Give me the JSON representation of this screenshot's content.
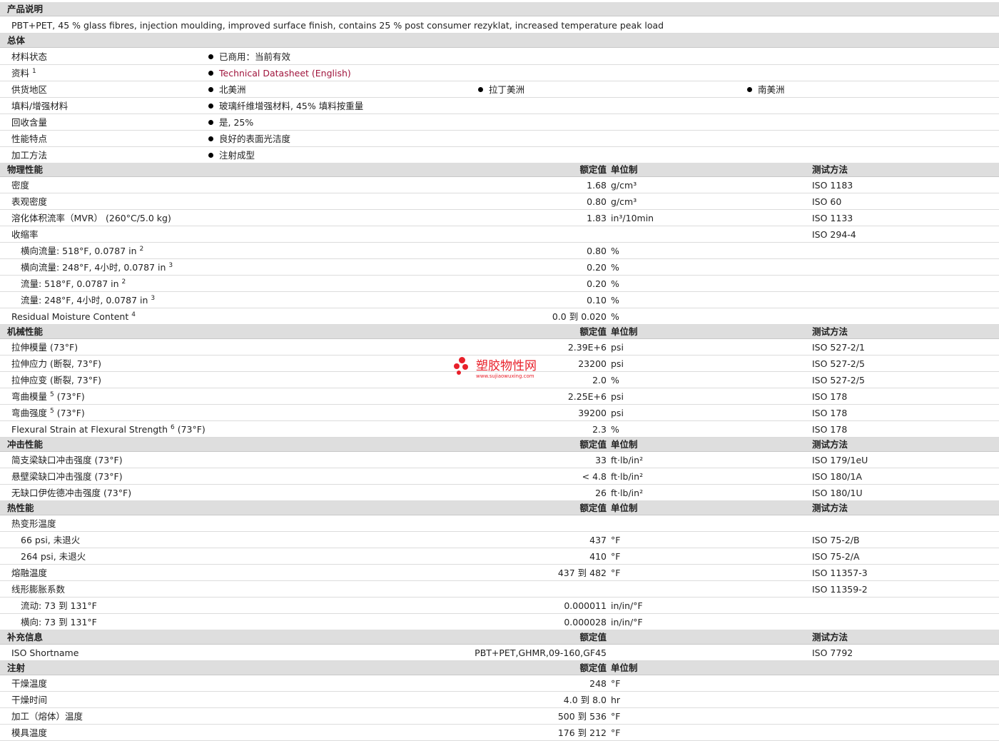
{
  "sections": {
    "product_desc": {
      "title": "产品说明",
      "text": "PBT+PET, 45 % glass fibres, injection moulding, improved surface finish, contains 25 % post consumer rezyklat, increased temperature peak load"
    },
    "general": {
      "title": "总体",
      "rows": [
        {
          "label": "材料状态",
          "sup": "",
          "items": [
            "已商用：当前有效"
          ]
        },
        {
          "label": "资料",
          "sup": "1",
          "items": [
            "Technical Datasheet (English)"
          ]
        },
        {
          "label": "供货地区",
          "sup": "",
          "items": [
            "北美洲",
            "拉丁美洲",
            "南美洲"
          ]
        },
        {
          "label": "填料/增强材料",
          "sup": "",
          "items": [
            "玻璃纤维增强材料, 45% 填料按重量"
          ]
        },
        {
          "label": "回收含量",
          "sup": "",
          "items": [
            "是, 25%"
          ]
        },
        {
          "label": "性能特点",
          "sup": "",
          "items": [
            "良好的表面光洁度"
          ]
        },
        {
          "label": "加工方法",
          "sup": "",
          "items": [
            "注射成型"
          ]
        }
      ]
    },
    "physical": {
      "title": "物理性能",
      "h_val": "额定值",
      "h_unit": "单位制",
      "h_test": "测试方法",
      "rows": [
        {
          "label": "密度",
          "val": "1.68",
          "unit": "g/cm³",
          "test": "ISO 1183"
        },
        {
          "label": "表观密度",
          "val": "0.80",
          "unit": "g/cm³",
          "test": "ISO 60"
        },
        {
          "label": "溶化体积流率（MVR） (260°C/5.0 kg)",
          "val": "1.83",
          "unit": "in³/10min",
          "test": "ISO 1133"
        },
        {
          "label": "收缩率",
          "val": "",
          "unit": "",
          "test": "ISO 294-4"
        },
        {
          "label": "横向流量: 518°F, 0.0787 in",
          "sup": "2",
          "indent": true,
          "val": "0.80",
          "unit": "%",
          "test": ""
        },
        {
          "label": "横向流量: 248°F, 4小时, 0.0787 in",
          "sup": "3",
          "indent": true,
          "val": "0.20",
          "unit": "%",
          "test": ""
        },
        {
          "label": "流量: 518°F, 0.0787 in",
          "sup": "2",
          "indent": true,
          "val": "0.20",
          "unit": "%",
          "test": ""
        },
        {
          "label": "流量: 248°F, 4小时, 0.0787 in",
          "sup": "3",
          "indent": true,
          "val": "0.10",
          "unit": "%",
          "test": ""
        },
        {
          "label": "Residual Moisture Content",
          "sup": "4",
          "val": "0.0 到 0.020",
          "unit": "%",
          "test": ""
        }
      ]
    },
    "mechanical": {
      "title": "机械性能",
      "h_val": "额定值",
      "h_unit": "单位制",
      "h_test": "测试方法",
      "rows": [
        {
          "label": "拉伸模量 (73°F)",
          "val": "2.39E+6",
          "unit": "psi",
          "test": "ISO 527-2/1"
        },
        {
          "label": "拉伸应力 (断裂, 73°F)",
          "val": "23200",
          "unit": "psi",
          "test": "ISO 527-2/5"
        },
        {
          "label": "拉伸应变 (断裂, 73°F)",
          "val": "2.0",
          "unit": "%",
          "test": "ISO 527-2/5"
        },
        {
          "label": "弯曲模量",
          "sup": "5",
          "suffix": " (73°F)",
          "val": "2.25E+6",
          "unit": "psi",
          "test": "ISO 178"
        },
        {
          "label": "弯曲强度",
          "sup": "5",
          "suffix": " (73°F)",
          "val": "39200",
          "unit": "psi",
          "test": "ISO 178"
        },
        {
          "label": "Flexural Strain at Flexural Strength",
          "sup": "6",
          "suffix": " (73°F)",
          "val": "2.3",
          "unit": "%",
          "test": "ISO 178"
        }
      ]
    },
    "impact": {
      "title": "冲击性能",
      "h_val": "额定值",
      "h_unit": "单位制",
      "h_test": "测试方法",
      "rows": [
        {
          "label": "简支梁缺口冲击强度 (73°F)",
          "val": "33",
          "unit": "ft·lb/in²",
          "test": "ISO 179/1eU"
        },
        {
          "label": "悬壁梁缺口冲击强度 (73°F)",
          "val": "< 4.8",
          "unit": "ft·lb/in²",
          "test": "ISO 180/1A"
        },
        {
          "label": "无缺口伊佐德冲击强度 (73°F)",
          "val": "26",
          "unit": "ft·lb/in²",
          "test": "ISO 180/1U"
        }
      ]
    },
    "thermal": {
      "title": "热性能",
      "h_val": "额定值",
      "h_unit": "单位制",
      "h_test": "测试方法",
      "rows": [
        {
          "label": "热变形温度",
          "val": "",
          "unit": "",
          "test": ""
        },
        {
          "label": "66 psi, 未退火",
          "indent": true,
          "val": "437",
          "unit": "°F",
          "test": "ISO 75-2/B"
        },
        {
          "label": "264 psi, 未退火",
          "indent": true,
          "val": "410",
          "unit": "°F",
          "test": "ISO 75-2/A"
        },
        {
          "label": "熔融温度",
          "val": "437 到  482",
          "unit": "°F",
          "test": "ISO 11357-3"
        },
        {
          "label": "线形膨胀系数",
          "val": "",
          "unit": "",
          "test": "ISO 11359-2"
        },
        {
          "label": "流动: 73 到  131°F",
          "indent": true,
          "val": "0.000011",
          "unit": "in/in/°F",
          "test": ""
        },
        {
          "label": "横向: 73 到  131°F",
          "indent": true,
          "val": "0.000028",
          "unit": "in/in/°F",
          "test": ""
        }
      ]
    },
    "supplemental": {
      "title": "补充信息",
      "h_val": "额定值",
      "h_unit": "",
      "h_test": "测试方法",
      "rows": [
        {
          "label": "ISO Shortname",
          "val": "PBT+PET,GHMR,09-160,GF45",
          "unit": "",
          "test": "ISO 7792"
        }
      ]
    },
    "injection": {
      "title": "注射",
      "h_val": "额定值",
      "h_unit": "单位制",
      "h_test": "",
      "rows": [
        {
          "label": "干燥温度",
          "val": "248",
          "unit": "°F",
          "test": ""
        },
        {
          "label": "干燥时间",
          "val": "4.0 到  8.0",
          "unit": "hr",
          "test": ""
        },
        {
          "label": "加工（熔体）温度",
          "val": "500 到  536",
          "unit": "°F",
          "test": ""
        },
        {
          "label": "模具温度",
          "val": "176 到  212",
          "unit": "°F",
          "test": ""
        }
      ]
    }
  },
  "watermark": {
    "title": "塑胶物性网",
    "url": "www.sujiaowuxing.com"
  },
  "colors": {
    "header_bg": "#dedede",
    "link": "#a0143c",
    "watermark": "#e8202a"
  }
}
